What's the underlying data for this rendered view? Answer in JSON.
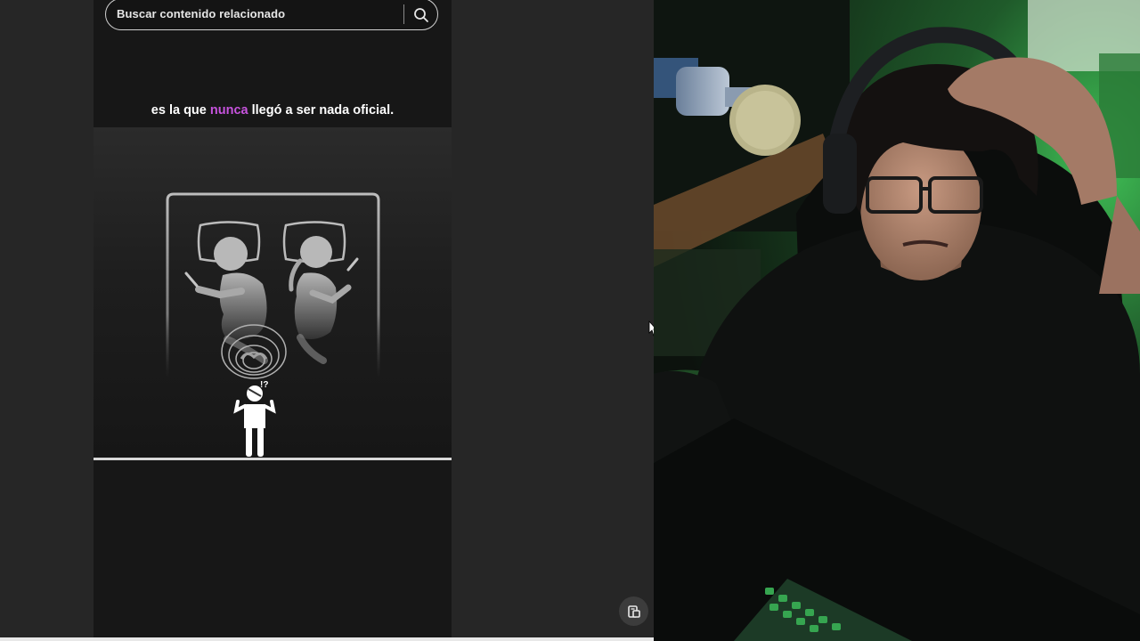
{
  "search": {
    "placeholder": "Buscar contenido relacionado",
    "icon": "search-icon"
  },
  "subtitle": {
    "before": "es la que ",
    "highlight": "nunca",
    "after": " llegó a ser nada oficial."
  },
  "illustration": {
    "mark": "!?"
  },
  "side_button": {
    "icon": "screen-capture-icon"
  },
  "colors": {
    "highlight": "#c653dd",
    "background": "#252525",
    "video_background": "#171717"
  }
}
